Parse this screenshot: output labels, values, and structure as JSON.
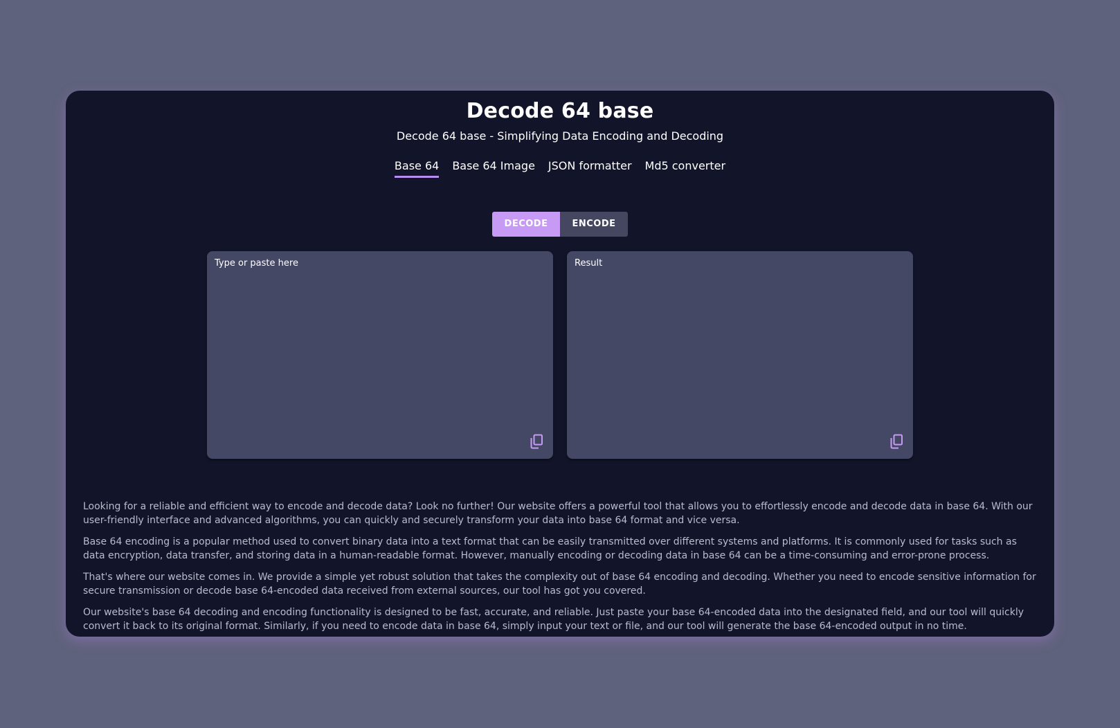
{
  "header": {
    "title": "Decode 64 base",
    "subtitle": "Decode 64 base - Simplifying Data Encoding and Decoding"
  },
  "nav": {
    "items": [
      {
        "label": "Base 64",
        "active": true
      },
      {
        "label": "Base 64 Image",
        "active": false
      },
      {
        "label": "JSON formatter",
        "active": false
      },
      {
        "label": "Md5 converter",
        "active": false
      }
    ]
  },
  "mode_toggle": {
    "decode_label": "DECODE",
    "encode_label": "ENCODE",
    "selected": "DECODE"
  },
  "input_panel": {
    "placeholder": "Type or paste here",
    "value": "",
    "copy_icon": "copy-icon"
  },
  "result_panel": {
    "placeholder": "Result",
    "value": "",
    "copy_icon": "copy-icon"
  },
  "description": {
    "paragraphs": [
      "Looking for a reliable and efficient way to encode and decode data? Look no further! Our website offers a powerful tool that allows you to effortlessly encode and decode data in base 64. With our user-friendly interface and advanced algorithms, you can quickly and securely transform your data into base 64 format and vice versa.",
      "Base 64 encoding is a popular method used to convert binary data into a text format that can be easily transmitted over different systems and platforms. It is commonly used for tasks such as data encryption, data transfer, and storing data in a human-readable format. However, manually encoding or decoding data in base 64 can be a time-consuming and error-prone process.",
      "That's where our website comes in. We provide a simple yet robust solution that takes the complexity out of base 64 encoding and decoding. Whether you need to encode sensitive information for secure transmission or decode base 64-encoded data received from external sources, our tool has got you covered.",
      "Our website's base 64 decoding and encoding functionality is designed to be fast, accurate, and reliable. Just paste your base 64-encoded data into the designated field, and our tool will quickly convert it back to its original format. Similarly, if you need to encode data in base 64, simply input your text or file, and our tool will generate the base 64-encoded output in no time."
    ]
  },
  "colors": {
    "page_background": "#5f627c",
    "card_background": "#12152a",
    "accent": "#c79bf5",
    "panel_background": "#454864",
    "text_muted": "#b9bccd"
  }
}
